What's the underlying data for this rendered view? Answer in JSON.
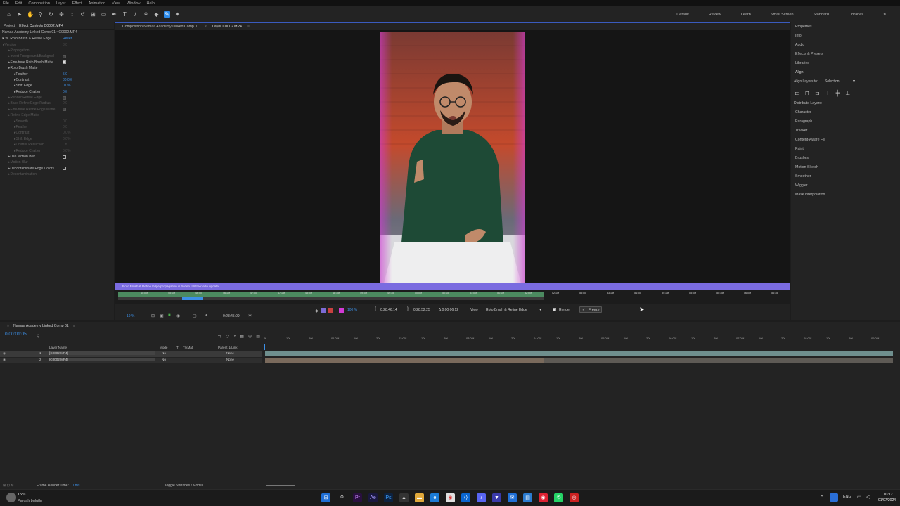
{
  "menubar": [
    "File",
    "Edit",
    "Composition",
    "Layer",
    "Effect",
    "Animation",
    "View",
    "Window",
    "Help"
  ],
  "workspaces": [
    "Default",
    "Review",
    "Learn",
    "Small Screen",
    "Standard",
    "Libraries"
  ],
  "effect_panel": {
    "tabs": [
      "Project",
      "Effect Controls C0002.MP4"
    ],
    "source": "Namaa Academy Linked Comp 01 • C0002.MP4",
    "effect_name": "Roto Brush & Refine Edge",
    "reset": "Reset",
    "rows": [
      {
        "label": "Version",
        "value": "3.0",
        "dim": true,
        "indent": 0
      },
      {
        "label": "Propagation",
        "dim": true,
        "indent": 1
      },
      {
        "label": "Invert Foreground/Backgrnd",
        "check": false,
        "dim": true,
        "indent": 1
      },
      {
        "label": "Fine-tune Roto Brush Matte",
        "check": true,
        "indent": 1
      },
      {
        "label": "Roto Brush Matte",
        "indent": 1
      },
      {
        "label": "Feather",
        "value": "5.0",
        "indent": 2
      },
      {
        "label": "Contrast",
        "value": "80.0%",
        "indent": 2
      },
      {
        "label": "Shift Edge",
        "value": "0.0%",
        "indent": 2
      },
      {
        "label": "Reduce Chatter",
        "value": "0%",
        "indent": 2
      },
      {
        "label": "Render Refine Edge",
        "check": true,
        "dim": true,
        "indent": 1
      },
      {
        "label": "Base Refine Edge Radius",
        "value": "0.0",
        "dim": true,
        "indent": 1
      },
      {
        "label": "Fine-tune Refine Edge Matte",
        "check": true,
        "dim": true,
        "indent": 1
      },
      {
        "label": "Refine Edge Matte",
        "dim": true,
        "indent": 1
      },
      {
        "label": "Smooth",
        "value": "0.0",
        "dim": true,
        "indent": 2
      },
      {
        "label": "Feather",
        "value": "0.0",
        "dim": true,
        "indent": 2
      },
      {
        "label": "Contrast",
        "value": "0.0%",
        "dim": true,
        "indent": 2
      },
      {
        "label": "Shift Edge",
        "value": "0.0%",
        "dim": true,
        "indent": 2
      },
      {
        "label": "Chatter Reduction",
        "value": "Off",
        "dim": true,
        "indent": 2
      },
      {
        "label": "Reduce Chatter",
        "value": "0.0%",
        "dim": true,
        "indent": 2
      },
      {
        "label": "Use Motion Blur",
        "check": false,
        "indent": 1
      },
      {
        "label": "Motion Blur",
        "dim": true,
        "indent": 1
      },
      {
        "label": "Decontaminate Edge Colors",
        "check": false,
        "indent": 1
      },
      {
        "label": "Decontamination",
        "dim": true,
        "indent": 1
      }
    ]
  },
  "comp_panel": {
    "tabs": [
      "Composition Namaa Academy Linked Comp 01",
      "Layer C0002.MP4"
    ],
    "warning": "Roto Brush & Refine Edge propagation is frozen. Unfreeze to update.",
    "ruler": [
      "45:00f",
      "45:15f",
      "46:00f",
      "46:15f",
      "47:00f",
      "47:15f",
      "48:00f",
      "48:15f",
      "49:00f",
      "49:15f",
      "50:00f",
      "50:15f",
      "51:00f",
      "51:15f",
      "52:00f",
      "52:15f",
      "53:00f",
      "53:15f",
      "54:00f",
      "54:15f",
      "55:00f",
      "55:15f",
      "56:00f",
      "56:15f"
    ],
    "in_time": "0:28:46:14",
    "out_time": "0:28:52:25",
    "duration": "Δ 0:00:06:12",
    "view_label": "View",
    "view_value": "Roto Brush & Refine Edge",
    "render_label": "Render",
    "freeze_label": "Freeze",
    "zoom": "19 %",
    "current_time": "0:28:45:09",
    "pct": "100 %"
  },
  "right_panel": {
    "items_top": [
      "Properties",
      "Info",
      "Audio",
      "Effects & Presets",
      "Libraries",
      "Align"
    ],
    "align_to_label": "Align Layers to:",
    "align_to_value": "Selection",
    "distribute": "Distribute Layers:",
    "items_bottom": [
      "Character",
      "Paragraph",
      "Tracker",
      "Content-Aware Fill",
      "Paint",
      "Brushes",
      "Motion Sketch",
      "Smoother",
      "Wiggler",
      "Mask Interpolation"
    ]
  },
  "timeline": {
    "tab": "Namaa Academy Linked Comp 01",
    "timecode": "0:00:01:05",
    "columns": [
      "Layer Name",
      "Mode",
      "T",
      "TrkMat",
      "Parent & Link"
    ],
    "layers": [
      {
        "num": "1",
        "name": "[C0002.MP4]",
        "mode": "No",
        "parent": "None"
      },
      {
        "num": "2",
        "name": "[C0002.MP4]",
        "mode": "No",
        "parent": "None"
      }
    ],
    "ruler": [
      "0f",
      "10f",
      "20f",
      "01:00f",
      "10f",
      "20f",
      "02:00f",
      "10f",
      "20f",
      "03:00f",
      "10f",
      "20f",
      "04:00f",
      "10f",
      "20f",
      "05:00f",
      "10f",
      "20f",
      "06:00f",
      "10f",
      "20f",
      "07:00f",
      "10f",
      "20f",
      "08:00f",
      "10f",
      "20f",
      "09:00f"
    ]
  },
  "statusbar": {
    "render_time_label": "Frame Render Time:",
    "render_time_value": "0ms",
    "toggle": "Toggle Switches / Modes"
  },
  "taskbar": {
    "weather_temp": "15°C",
    "weather_desc": "Parçalı bulutlu",
    "lang": "ENG",
    "time": "03:12",
    "date": "01/07/2024"
  },
  "colors": {
    "accent": "#2d8ceb",
    "warn": "#7a6be0",
    "layer_bar": "#6f8f8e"
  }
}
